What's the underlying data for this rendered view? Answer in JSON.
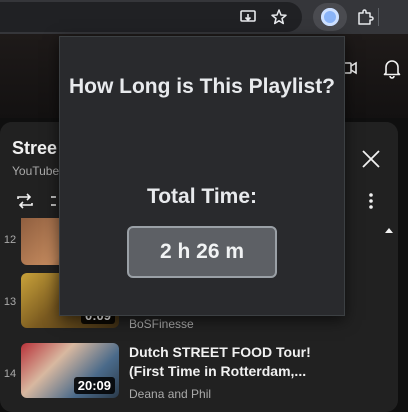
{
  "extension_popup": {
    "heading": "How Long is This Playlist?",
    "total_label": "Total Time:",
    "total_value": "2 h 26 m"
  },
  "browser": {
    "icons": [
      "cast-icon",
      "bookmark-star-icon",
      "extension-logo-icon",
      "extensions-puzzle-icon"
    ]
  },
  "playlist": {
    "title": "Stree",
    "subtitle": "YouTube",
    "videos": [
      {
        "index": "12",
        "title": "",
        "channel": "",
        "duration": ""
      },
      {
        "index": "13",
        "title": "",
        "channel": "BoSFinesse",
        "duration": "0:09"
      },
      {
        "index": "14",
        "title_line1": "Dutch STREET FOOD Tour!",
        "title_line2": "(First Time in Rotterdam,...",
        "channel": "Deana and Phil",
        "duration": "20:09"
      }
    ]
  },
  "colors": {
    "popup_bg": "#292a2d",
    "value_box": "#5d6065",
    "page_bg": "#0f0f0f"
  }
}
